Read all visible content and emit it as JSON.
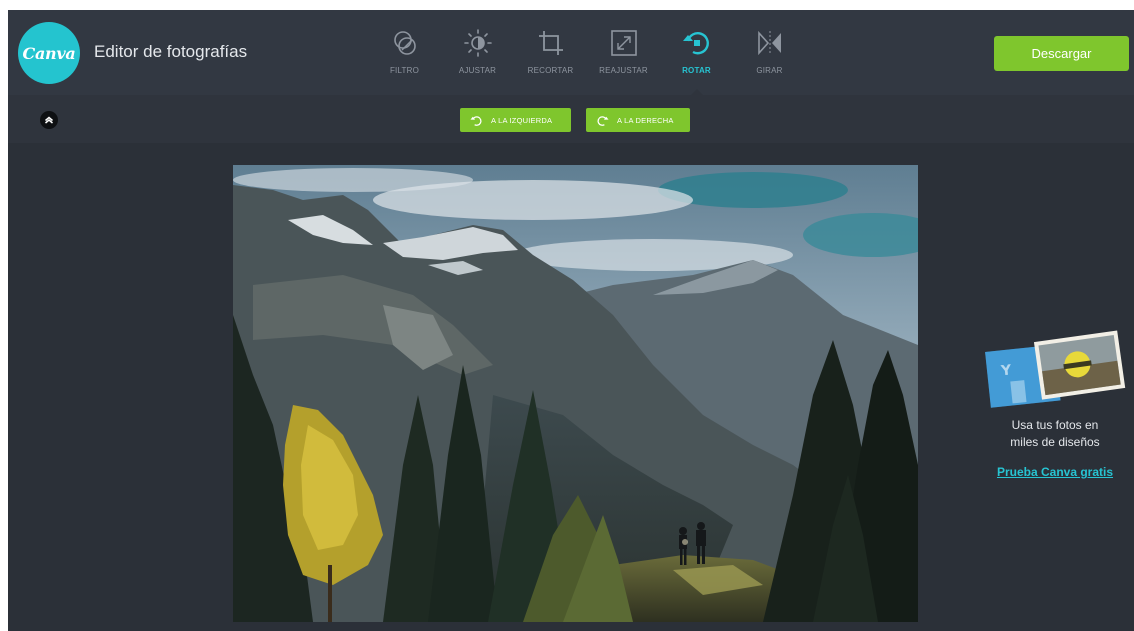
{
  "header": {
    "logo_text": "Canva",
    "title": "Editor de fotografías",
    "download_label": "Descargar"
  },
  "tools": [
    {
      "label": "FILTRO",
      "icon": "filter-icon"
    },
    {
      "label": "AJUSTAR",
      "icon": "adjust-icon"
    },
    {
      "label": "RECORTAR",
      "icon": "crop-icon"
    },
    {
      "label": "REAJUSTAR",
      "icon": "resize-icon"
    },
    {
      "label": "ROTAR",
      "icon": "rotate-icon",
      "active": true
    },
    {
      "label": "GIRAR",
      "icon": "flip-icon"
    }
  ],
  "subbar": {
    "rotate_left_label": "A LA IZQUIERDA",
    "rotate_right_label": "A LA DERECHA"
  },
  "promo": {
    "line1": "Usa tus fotos en",
    "line2": "miles de diseños",
    "link": "Prueba Canva gratis"
  },
  "colors": {
    "accent": "#27c4d2",
    "green": "#7fc62d",
    "header_bg": "#323842",
    "canvas_bg": "#2b3038"
  }
}
